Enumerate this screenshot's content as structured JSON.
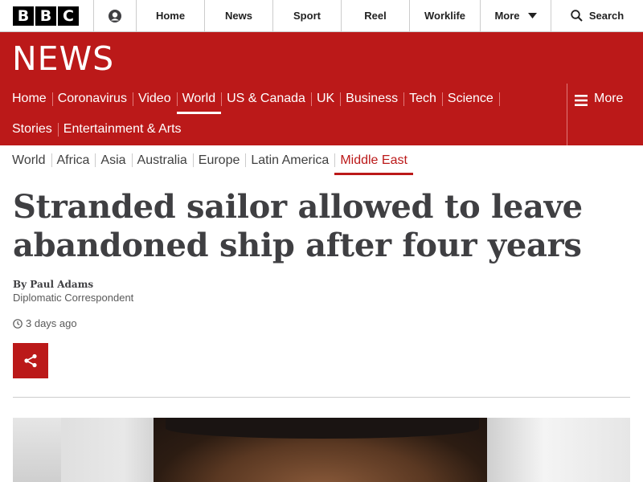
{
  "bbc_bar": {
    "logo_letters": [
      "B",
      "B",
      "C"
    ],
    "nav": [
      "Home",
      "News",
      "Sport",
      "Reel",
      "Worklife"
    ],
    "more_label": "More",
    "search_label": "Search"
  },
  "banner": {
    "title": "NEWS"
  },
  "main_nav": {
    "row1": [
      "Home",
      "Coronavirus",
      "Video",
      "World",
      "US & Canada",
      "UK",
      "Business",
      "Tech",
      "Science"
    ],
    "row2": [
      "Stories",
      "Entertainment & Arts"
    ],
    "active": "World",
    "more_label": "More"
  },
  "sub_nav": {
    "items": [
      "World",
      "Africa",
      "Asia",
      "Australia",
      "Europe",
      "Latin America",
      "Middle East"
    ],
    "active": "Middle East"
  },
  "article": {
    "headline": "Stranded sailor allowed to leave abandoned ship after four years",
    "byline_name": "By Paul Adams",
    "byline_role": "Diplomatic Correspondent",
    "timestamp": "3 days ago"
  },
  "colors": {
    "brand_red": "#bb1919",
    "text_dark": "#3f3f42"
  }
}
